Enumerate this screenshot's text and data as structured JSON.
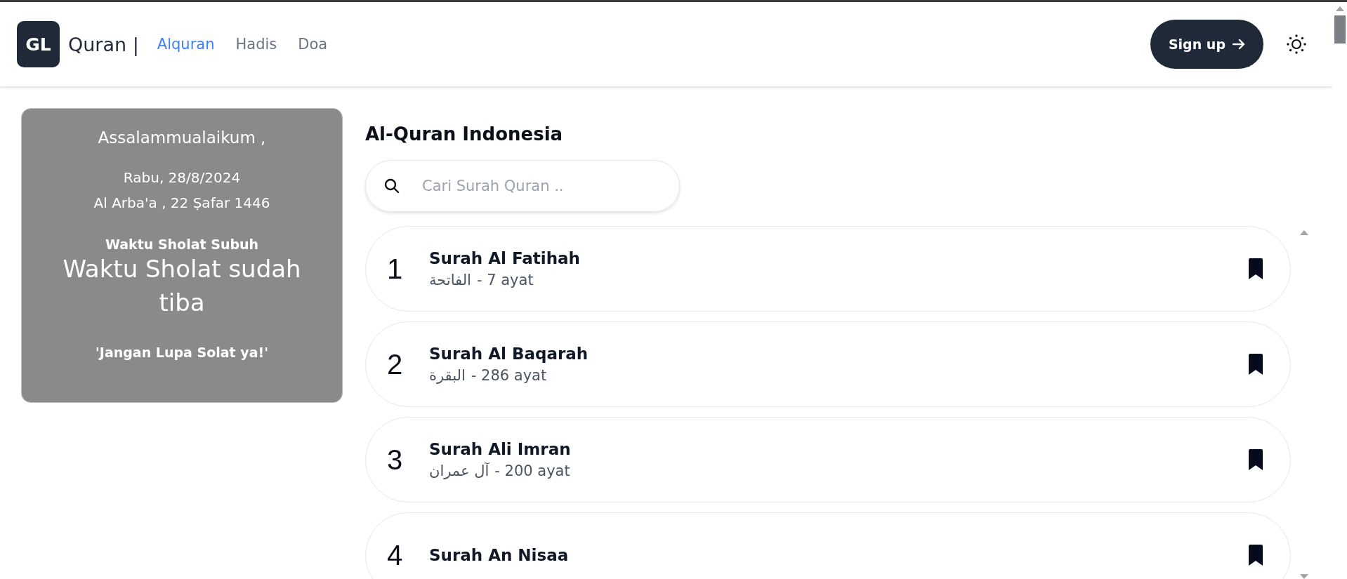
{
  "header": {
    "logo": "GL",
    "brand": "Quran |",
    "nav": [
      {
        "label": "Alquran",
        "selected": true
      },
      {
        "label": "Hadis",
        "selected": false
      },
      {
        "label": "Doa",
        "selected": false
      }
    ],
    "signup": "Sign up"
  },
  "greeting_card": {
    "greeting": "Assalammualaikum ,",
    "date": "Rabu, 28/8/2024",
    "hijri_date": "Al Arba'a , 22 Ṣafar 1446",
    "prayer_label": "Waktu Sholat Subuh",
    "prayer_status": "Waktu Sholat sudah tiba",
    "reminder": "'Jangan Lupa Solat ya!'"
  },
  "main": {
    "title": "Al-Quran Indonesia",
    "search": {
      "placeholder": "Cari Surah Quran .."
    },
    "surahs": [
      {
        "number": "1",
        "name": "Surah Al Fatihah",
        "arabic": "الفاتحة",
        "ayat": "- 7 ayat"
      },
      {
        "number": "2",
        "name": "Surah Al Baqarah",
        "arabic": "البقرة",
        "ayat": "- 286 ayat"
      },
      {
        "number": "3",
        "name": "Surah Ali Imran",
        "arabic": "آل عمران",
        "ayat": "- 200 ayat"
      },
      {
        "number": "4",
        "name": "Surah An Nisaa"
      }
    ]
  }
}
